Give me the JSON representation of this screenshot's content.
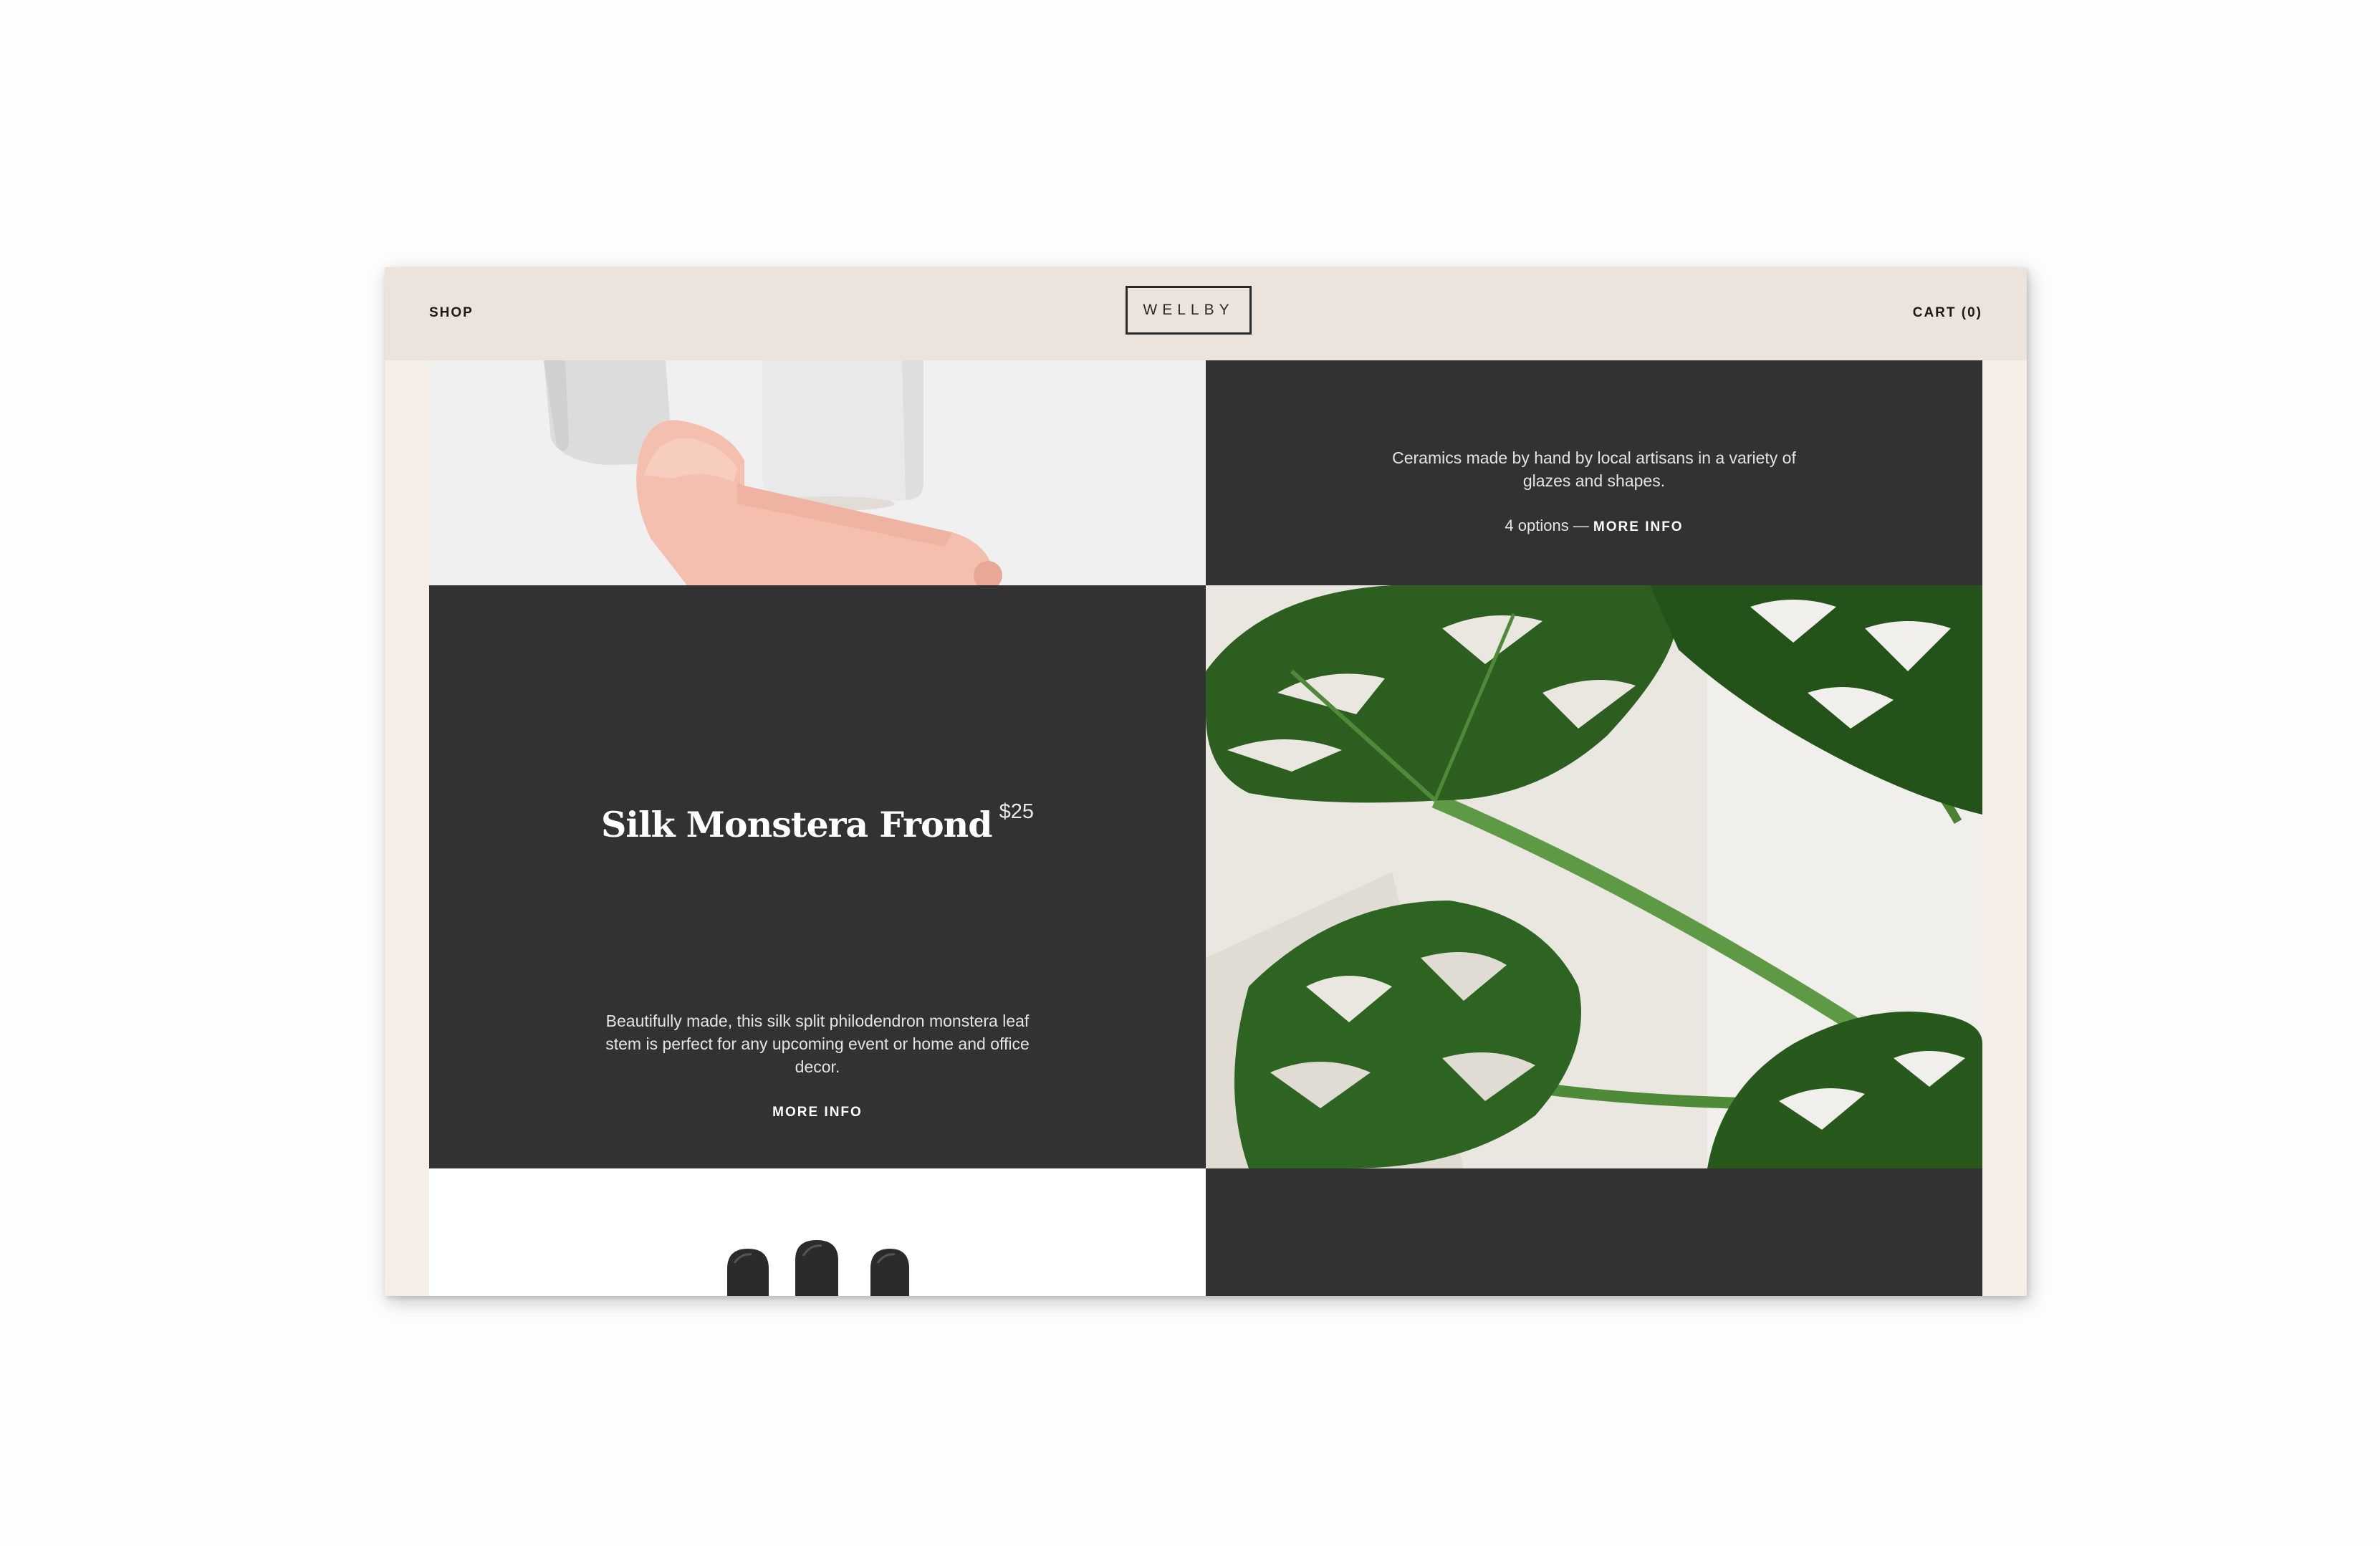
{
  "header": {
    "shop_label": "SHOP",
    "logo_text": "WELLBY",
    "cart_label": "CART (0)"
  },
  "ceramics": {
    "description": "Ceramics made by hand by local artisans in a variety of glazes and shapes.",
    "options_text": "4 options — ",
    "more_info": "MORE INFO"
  },
  "product": {
    "name": "Silk Monstera Frond",
    "price": "$25",
    "description": "Beautifully made, this silk split philodendron monstera leaf stem is perfect for any upcoming event or home and office decor.",
    "more_info": "MORE INFO"
  },
  "colors": {
    "header_bg": "#ece4dc",
    "page_bg": "#f4eee6",
    "dark_tile": "#323232",
    "vase_pink": "#f2b9a8",
    "leaf_green": "#2f5e22"
  }
}
